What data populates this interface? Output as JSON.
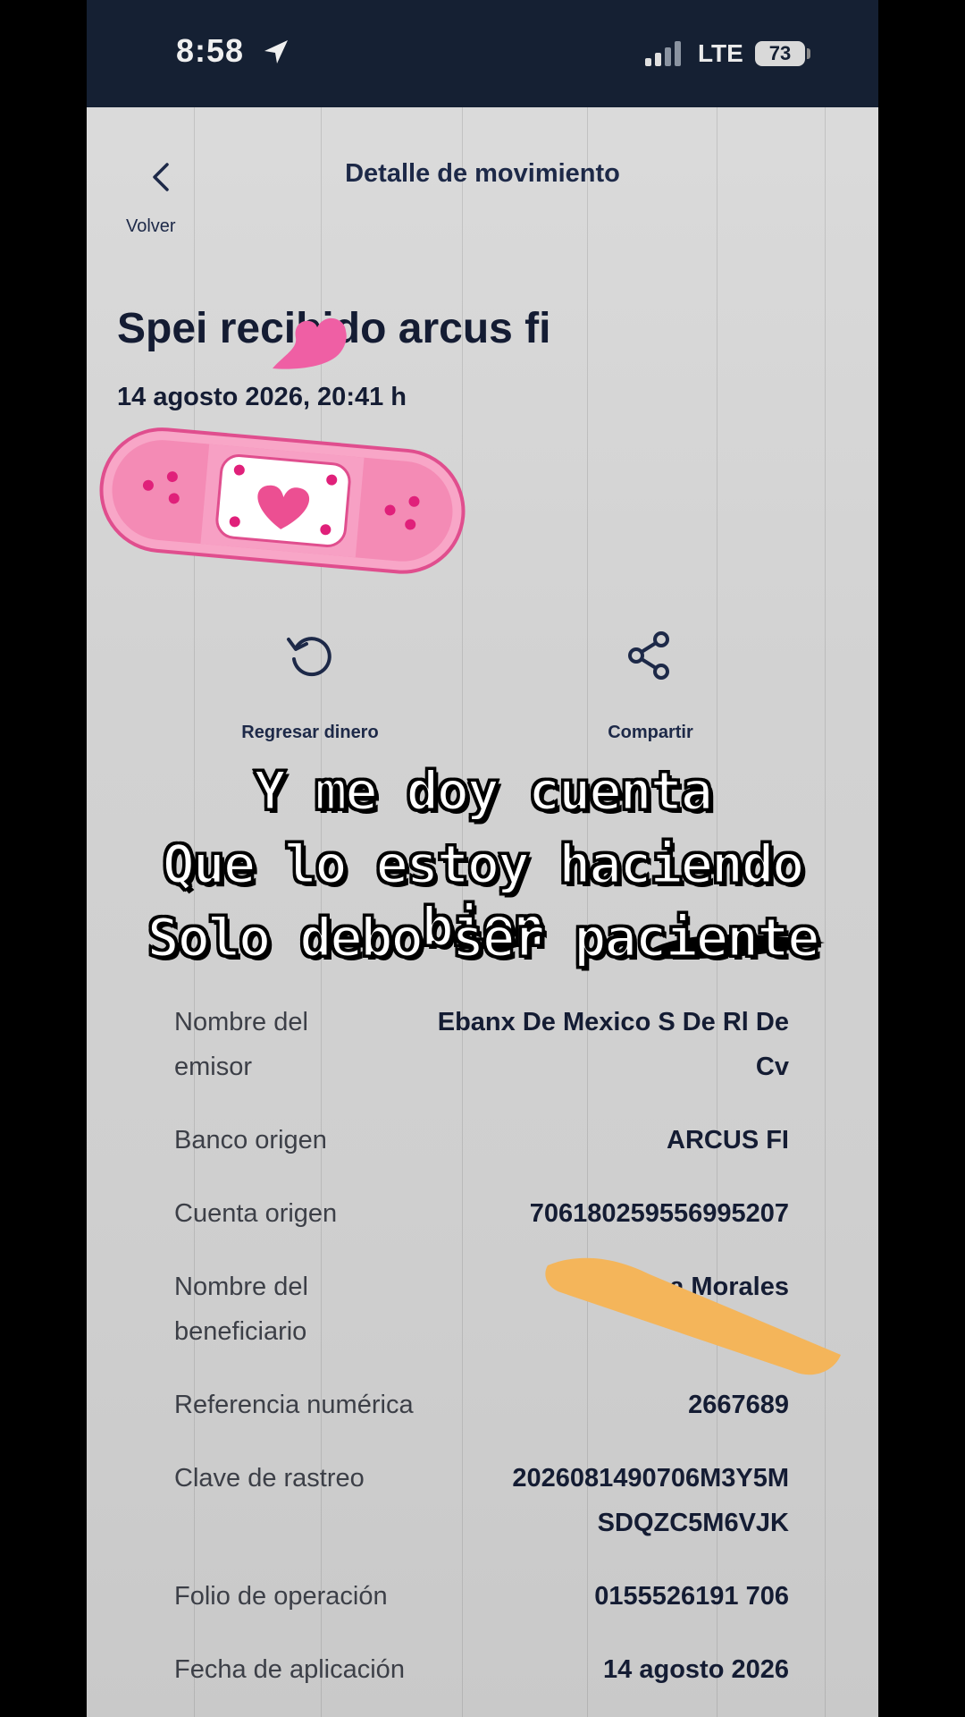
{
  "status_bar": {
    "time": "8:58",
    "network": "LTE",
    "battery": "73"
  },
  "header": {
    "title": "Detalle de movimiento",
    "back_label": "Volver"
  },
  "movement": {
    "title": "Spei recibido arcus fi",
    "date": "14 agosto 2026, 20:41 h"
  },
  "actions": {
    "refund_label": "Regresar dinero",
    "share_label": "Compartir"
  },
  "caption": {
    "line1": "Y me doy cuenta",
    "line2": "Que lo estoy haciendo bien",
    "line3": "Solo debo ser paciente"
  },
  "details": [
    {
      "label": "Nombre del emisor",
      "value": "Ebanx De Mexico S De Rl De Cv"
    },
    {
      "label": "Banco origen",
      "value": "ARCUS FI"
    },
    {
      "label": "Cuenta origen",
      "value": "706180259556995207"
    },
    {
      "label": "Nombre del beneficiario",
      "value": "Vanessa Morales"
    },
    {
      "label": "Referencia numérica",
      "value": "2667689"
    },
    {
      "label": "Clave de rastreo",
      "value": "2026081490706M3Y5MSDQZC5M6VJK"
    },
    {
      "label": "Folio de operación",
      "value": "0155526191 706"
    },
    {
      "label": "Fecha de aplicación",
      "value": "14 agosto 2026"
    }
  ],
  "colors": {
    "status_bar_bg": "#152033",
    "text_primary": "#141c33",
    "accent_navy": "#1d2948",
    "bandage_pink": "#f48bb5",
    "redaction_orange": "#f4b55a"
  },
  "decorations": [
    "heart-sticker",
    "bandage-sticker",
    "orange-redaction-scribble",
    "black-scribble"
  ]
}
